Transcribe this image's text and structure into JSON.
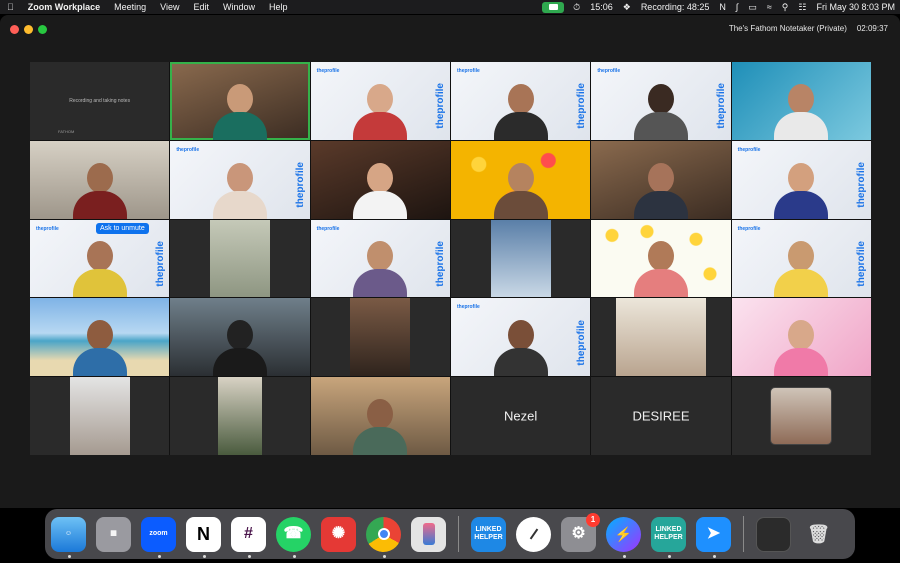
{
  "menubar": {
    "app_name": "Zoom Workplace",
    "menus": [
      "Meeting",
      "View",
      "Edit",
      "Window",
      "Help"
    ],
    "time_indicator": "15:06",
    "recording": "Recording: 48:25",
    "datetime": "Fri May 30  8:03 PM"
  },
  "window": {
    "notetaker_label": "The's Fathom Notetaker (Private)",
    "meeting_timer": "02:09:37"
  },
  "tiles": {
    "notetaker_title": "Recording and taking notes",
    "notetaker_footer": "FATHOM",
    "brand_name": "theprofile",
    "unmute_label": "Ask to unmute",
    "more_label": "···",
    "name_nezel": "Nezel",
    "name_desiree": "DESIREE"
  },
  "dock": {
    "zoom_label": "zoom",
    "linked_helper_label": "LINKED HELPER",
    "settings_badge": "1"
  }
}
